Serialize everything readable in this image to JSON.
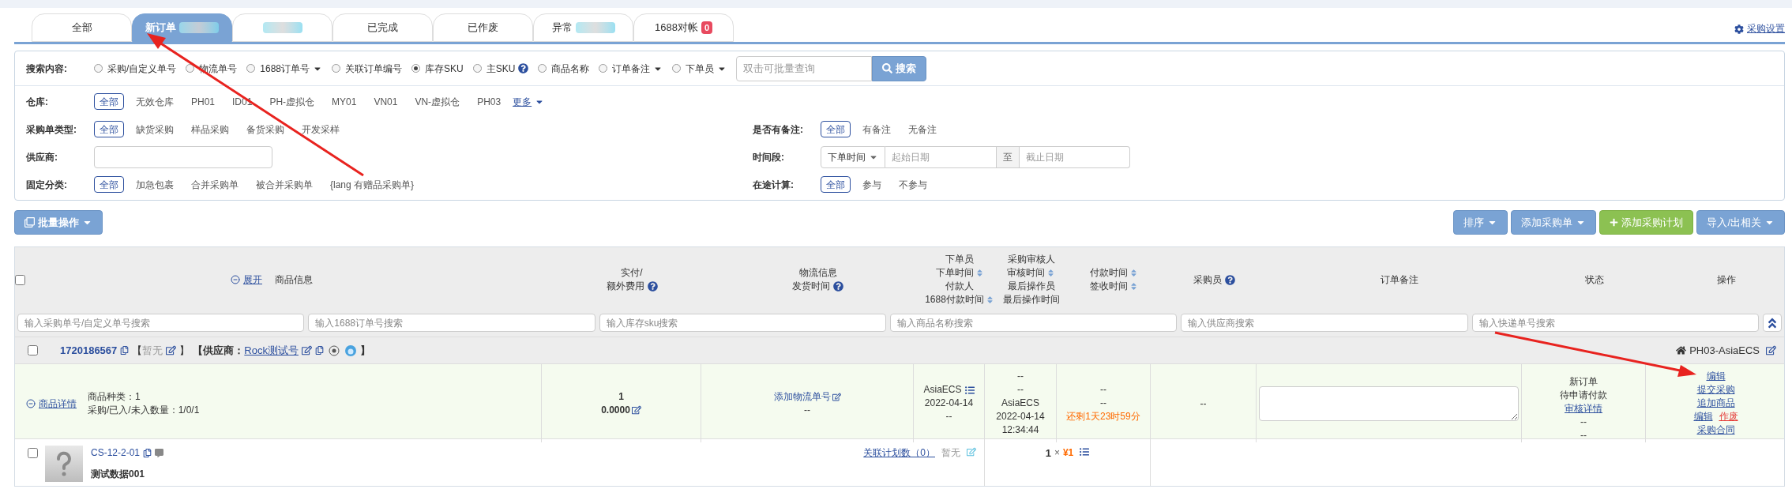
{
  "tabs": [
    {
      "label": "全部",
      "selected": false,
      "redacted": false
    },
    {
      "label": "新订单",
      "selected": true,
      "redacted": true
    },
    {
      "selected": false,
      "redacted": true
    },
    {
      "label": "已完成",
      "selected": false,
      "redacted": false
    },
    {
      "label": "已作废",
      "selected": false,
      "redacted": false
    },
    {
      "label": "异常",
      "selected": false,
      "redacted": true
    },
    {
      "label": "1688对帐",
      "selected": false,
      "redacted": false,
      "badge": "0"
    }
  ],
  "settings_link": "采购设置",
  "search": {
    "label": "搜索内容:",
    "placeholder": "双击可批量查询",
    "button": "搜索",
    "options": [
      {
        "label": "采购/自定义单号",
        "selected": false,
        "dropdown": false,
        "help": false
      },
      {
        "label": "物流单号",
        "selected": false,
        "dropdown": false,
        "help": false
      },
      {
        "label": "1688订单号",
        "selected": false,
        "dropdown": true,
        "help": false
      },
      {
        "label": "关联订单编号",
        "selected": false,
        "dropdown": false,
        "help": false
      },
      {
        "label": "库存SKU",
        "selected": true,
        "dropdown": false,
        "help": false
      },
      {
        "label": "主SKU",
        "selected": false,
        "dropdown": false,
        "help": true
      },
      {
        "label": "商品名称",
        "selected": false,
        "dropdown": false,
        "help": false
      },
      {
        "label": "订单备注",
        "selected": false,
        "dropdown": true,
        "help": false
      },
      {
        "label": "下单员",
        "selected": false,
        "dropdown": true,
        "help": false
      }
    ]
  },
  "filters_left": [
    {
      "kind": "chips",
      "label": "仓库:",
      "more": "更多",
      "chips": [
        {
          "label": "全部",
          "selected": true
        },
        {
          "label": "无效仓库",
          "selected": false
        },
        {
          "label": "PH01",
          "selected": false
        },
        {
          "label": "ID01",
          "selected": false
        },
        {
          "label": "PH-虚拟仓",
          "selected": false
        },
        {
          "label": "MY01",
          "selected": false
        },
        {
          "label": "VN01",
          "selected": false
        },
        {
          "label": "VN-虚拟仓",
          "selected": false
        },
        {
          "label": "PH03",
          "selected": false
        }
      ]
    },
    {
      "kind": "chips",
      "label": "采购单类型:",
      "chips": [
        {
          "label": "全部",
          "selected": true
        },
        {
          "label": "缺货采购",
          "selected": false
        },
        {
          "label": "样品采购",
          "selected": false
        },
        {
          "label": "备货采购",
          "selected": false
        },
        {
          "label": "开发采样",
          "selected": false
        }
      ]
    },
    {
      "kind": "input",
      "label": "供应商:"
    },
    {
      "kind": "chips",
      "label": "固定分类:",
      "chips": [
        {
          "label": "全部",
          "selected": true
        },
        {
          "label": "加急包裹",
          "selected": false
        },
        {
          "label": "合并采购单",
          "selected": false
        },
        {
          "label": "被合并采购单",
          "selected": false
        },
        {
          "label": "{lang 有赠品采购单}",
          "selected": false
        }
      ]
    }
  ],
  "filters_right": [
    {
      "kind": "chips",
      "label": "是否有备注:",
      "chips": [
        {
          "label": "全部",
          "selected": true
        },
        {
          "label": "有备注",
          "selected": false
        },
        {
          "label": "无备注",
          "selected": false
        }
      ]
    },
    {
      "kind": "daterange",
      "label": "时间段:",
      "select": "下单时间",
      "start_placeholder": "起始日期",
      "separator": "至",
      "end_placeholder": "截止日期"
    },
    {
      "kind": "chips",
      "label": "在途计算:",
      "chips": [
        {
          "label": "全部",
          "selected": true
        },
        {
          "label": "参与",
          "selected": false
        },
        {
          "label": "不参与",
          "selected": false
        }
      ]
    }
  ],
  "batch_button": "批量操作",
  "toolbar_buttons": [
    {
      "label": "排序",
      "kind": "dropdown"
    },
    {
      "label": "添加采购单",
      "kind": "dropdown"
    },
    {
      "label": "添加采购计划",
      "kind": "add"
    },
    {
      "label": "导入/出相关",
      "kind": "dropdown"
    }
  ],
  "select_all_checked": false,
  "columns": [
    {
      "kind": "product",
      "toggle": "展开",
      "label": "商品信息"
    },
    {
      "kind": "lines",
      "lines": [
        {
          "text": "实付/",
          "help": false,
          "sortable": false
        },
        {
          "text": "额外费用",
          "help": true,
          "sortable": false
        }
      ]
    },
    {
      "kind": "lines",
      "lines": [
        {
          "text": "物流信息",
          "help": false,
          "sortable": false
        },
        {
          "text": "发货时间",
          "help": true,
          "sortable": false
        }
      ]
    },
    {
      "kind": "lines",
      "lines": [
        {
          "text": "下单员",
          "help": false,
          "sortable": false
        },
        {
          "text": "下单时间",
          "help": false,
          "sortable": true
        },
        {
          "text": "付款人",
          "help": false,
          "sortable": false
        },
        {
          "text": "1688付款时间",
          "help": false,
          "sortable": true
        }
      ]
    },
    {
      "kind": "lines",
      "lines": [
        {
          "text": "采购审核人",
          "help": false,
          "sortable": false
        },
        {
          "text": "审核时间",
          "help": false,
          "sortable": true
        },
        {
          "text": "最后操作员",
          "help": false,
          "sortable": false
        },
        {
          "text": "最后操作时间",
          "help": false,
          "sortable": false
        }
      ]
    },
    {
      "kind": "lines",
      "lines": [
        {
          "text": "付款时间",
          "help": false,
          "sortable": true
        },
        {
          "text": "签收时间",
          "help": false,
          "sortable": true
        }
      ]
    },
    {
      "kind": "lines",
      "lines": [
        {
          "text": "采购员",
          "help": true,
          "sortable": false
        }
      ]
    },
    {
      "kind": "lines",
      "lines": [
        {
          "text": "订单备注",
          "help": false,
          "sortable": false
        }
      ]
    },
    {
      "kind": "lines",
      "lines": [
        {
          "text": "状态",
          "help": false,
          "sortable": false
        }
      ]
    },
    {
      "kind": "lines",
      "lines": [
        {
          "text": "操作",
          "help": false,
          "sortable": false
        }
      ]
    }
  ],
  "column_filters": [
    {
      "placeholder": "输入采购单号/自定义单号搜索"
    },
    {
      "placeholder": "输入1688订单号搜索"
    },
    {
      "placeholder": "输入库存sku搜索"
    },
    {
      "placeholder": "输入商品名称搜索"
    },
    {
      "placeholder": "输入供应商搜索"
    },
    {
      "placeholder": "输入快递单号搜索"
    }
  ],
  "order": {
    "checked": false,
    "id": "1720186567",
    "note_open": "【",
    "note": "暂无",
    "note_close": "】",
    "supplier_open": "【供应商：",
    "supplier": "Rock测试号",
    "supplier_close": "】",
    "warehouse": "PH03-AsiaECS",
    "toggle": "商品详情",
    "summary": [
      "商品种类：1",
      "采购/已入/未入数量：1/0/1"
    ],
    "paid": "1",
    "extra": "0.0000",
    "logistics_link": "添加物流单号",
    "logistics": "--",
    "placer": [
      "AsiaECS",
      "2022-04-14",
      "--"
    ],
    "audit": [
      "--",
      "--",
      "AsiaECS",
      "2022-04-14 12:34:44"
    ],
    "pay": [
      "--",
      "--"
    ],
    "countdown": "还剩1天23时59分",
    "buyer": "--",
    "status": [
      {
        "text": "新订单",
        "link": false
      },
      {
        "text": "待申请付款",
        "link": false
      },
      {
        "text": "审核详情",
        "link": true
      },
      {
        "text": "--",
        "link": false
      },
      {
        "text": "--",
        "link": false
      }
    ],
    "actions": [
      [
        {
          "label": "编辑",
          "danger": false
        }
      ],
      [
        {
          "label": "提交采购",
          "danger": false
        }
      ],
      [
        {
          "label": "追加商品",
          "danger": false
        }
      ],
      [
        {
          "label": "编辑",
          "danger": false
        },
        {
          "label": "作废",
          "danger": true
        }
      ],
      [
        {
          "label": "采购合同",
          "danger": false
        }
      ]
    ],
    "item": {
      "checked": false,
      "sku": "CS-12-2-01",
      "name": "测试数据001",
      "plan_link": "关联计划数（0）",
      "note": "暂无",
      "qty": "1",
      "times": "×",
      "price": "¥1"
    }
  }
}
